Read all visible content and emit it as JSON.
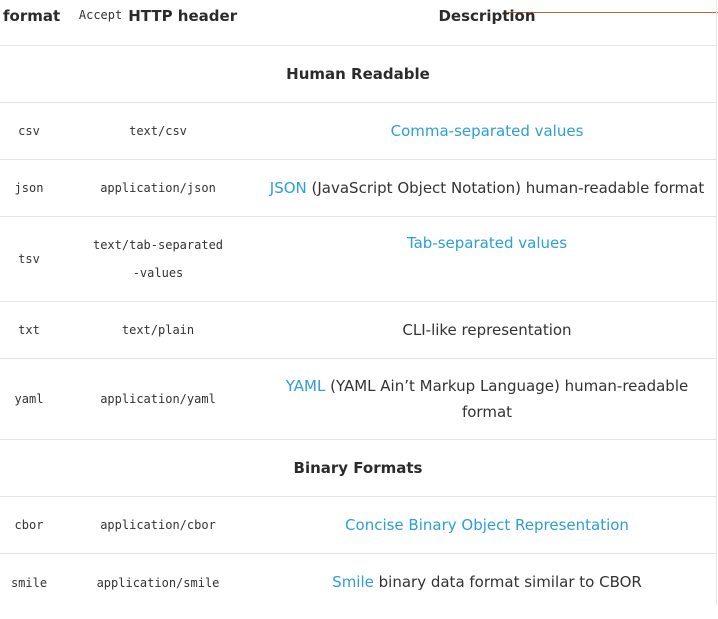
{
  "header": {
    "format": "format",
    "accept_code": "Accept",
    "http_header": "HTTP header",
    "description": "Description"
  },
  "sections": {
    "human": "Human Readable",
    "binary": "Binary Formats"
  },
  "rows": [
    {
      "format": "csv",
      "header": "text/csv",
      "link": "Comma-separated values",
      "rest": ""
    },
    {
      "format": "json",
      "header": "application/json",
      "link": "JSON",
      "rest": " (JavaScript Object Notation) human-readable format"
    },
    {
      "format": "tsv",
      "header": "text/tab-separated-values",
      "link": "Tab-separated values",
      "rest": ""
    },
    {
      "format": "txt",
      "header": "text/plain",
      "link": "",
      "rest": "CLI-like representation"
    },
    {
      "format": "yaml",
      "header": "application/yaml",
      "link": "YAML",
      "rest": " (YAML Ain’t Markup Language) human-readable format"
    },
    {
      "format": "cbor",
      "header": "application/cbor",
      "link": "Concise Binary Object Representation",
      "rest": ""
    },
    {
      "format": "smile",
      "header": "application/smile",
      "link": "Smile",
      "rest": " binary data format similar to CBOR"
    }
  ],
  "colors": {
    "link": "#2c9fd6",
    "accent_line": "#b86a3c",
    "border": "#e4e4e4"
  }
}
